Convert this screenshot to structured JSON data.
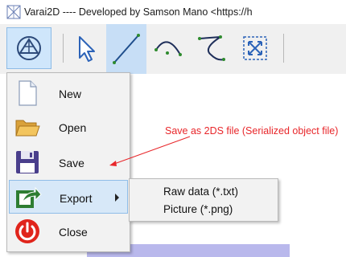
{
  "window": {
    "title": "Varai2D ---- Developed by Samson Mano <https://h",
    "icon": "app-logo-icon"
  },
  "toolbar": {
    "tools": [
      {
        "name": "app-menu-button",
        "icon": "triangle-app-icon",
        "selected": true
      },
      {
        "name": "select-tool-button",
        "icon": "pointer-arrow-icon"
      },
      {
        "name": "line-tool-button",
        "icon": "line-icon",
        "selected": true
      },
      {
        "name": "arc-tool-button",
        "icon": "arc-icon"
      },
      {
        "name": "curve-tool-button",
        "icon": "curve-icon"
      },
      {
        "name": "fit-view-button",
        "icon": "fit-frame-icon"
      }
    ]
  },
  "menu": {
    "items": [
      {
        "label": "New",
        "icon": "new-file-icon"
      },
      {
        "label": "Open",
        "icon": "open-folder-icon"
      },
      {
        "label": "Save",
        "icon": "floppy-disk-icon"
      },
      {
        "label": "Export",
        "icon": "export-icon",
        "has_submenu": true,
        "highlighted": true
      },
      {
        "label": "Close",
        "icon": "power-icon"
      }
    ]
  },
  "submenu": {
    "items": [
      {
        "label": "Raw data (*.txt)"
      },
      {
        "label": "Picture (*.png)"
      }
    ]
  },
  "annotation": {
    "text": "Save as 2DS file (Serialized object file)",
    "color": "#e8262a"
  },
  "colors": {
    "menu_highlight": "#d7e8f8",
    "toolbar_bg": "#f0f0f0",
    "canvas": "#b9b8ec"
  }
}
